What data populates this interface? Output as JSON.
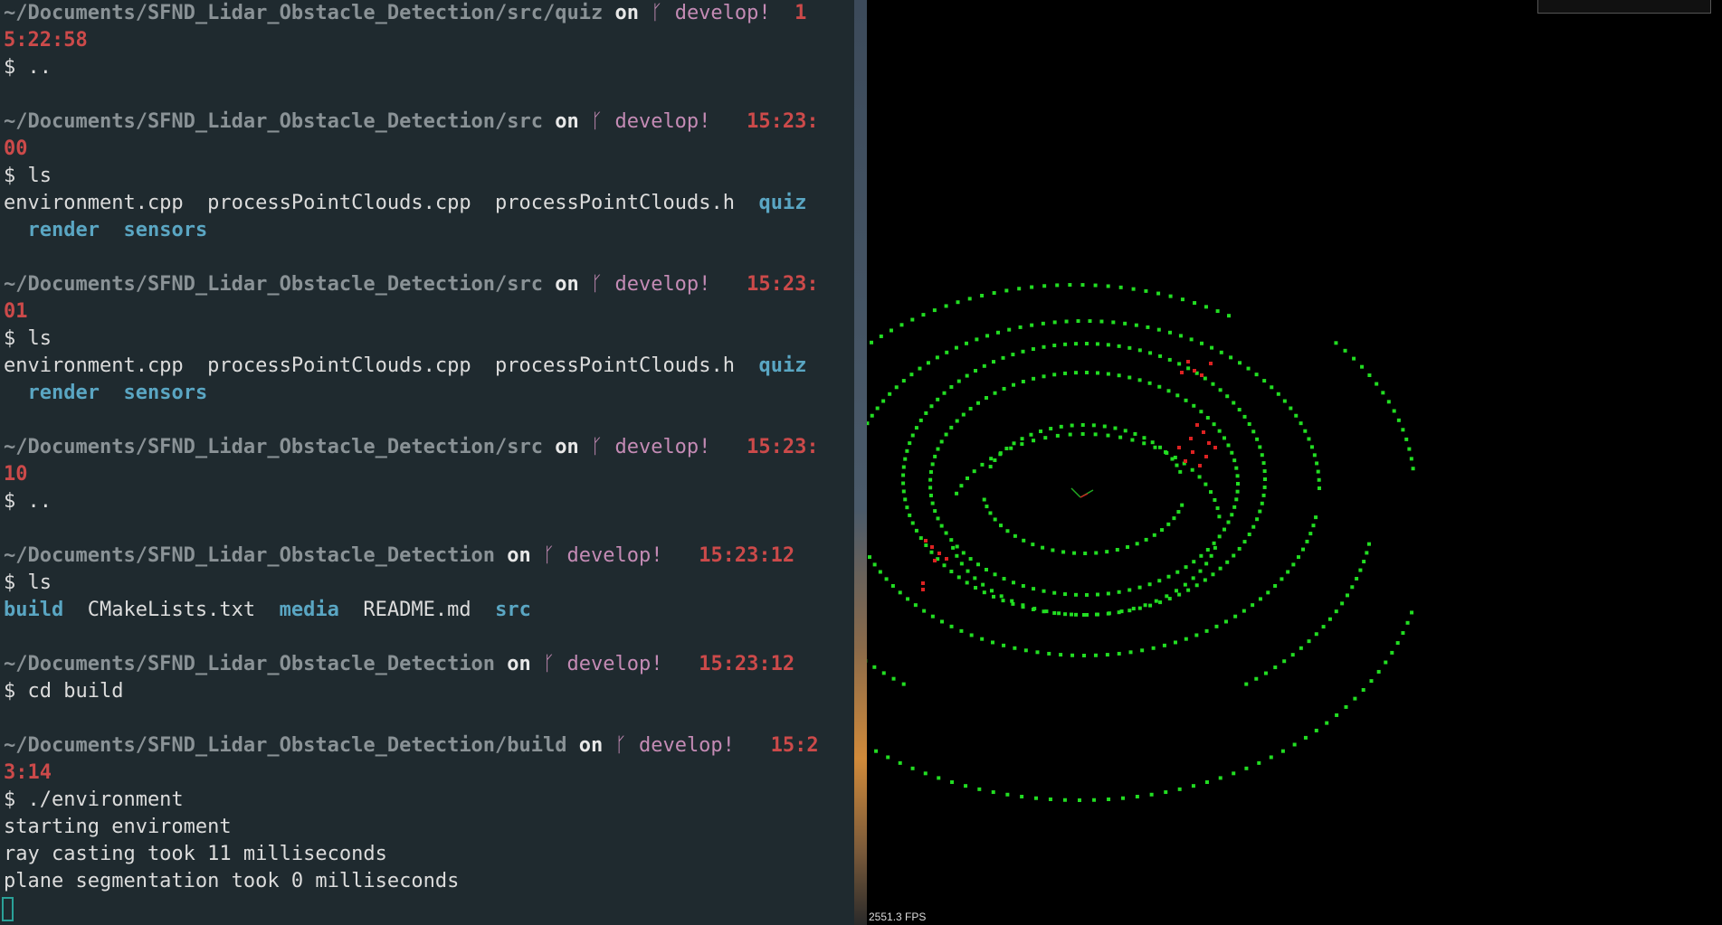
{
  "terminal": {
    "lines": [
      {
        "segs": [
          {
            "c": "path",
            "t": "~/Documents/SFND_Lidar_Obstacle_Detection/src/quiz"
          },
          {
            "c": "on",
            "t": " on "
          },
          {
            "c": "branch",
            "t": "ᚴ develop! "
          },
          {
            "c": "time",
            "t": " 1"
          }
        ]
      },
      {
        "segs": [
          {
            "c": "time",
            "t": "5:22:58"
          }
        ]
      },
      {
        "segs": [
          {
            "c": "text",
            "t": "$ .."
          }
        ]
      },
      {
        "segs": []
      },
      {
        "segs": [
          {
            "c": "path",
            "t": "~/Documents/SFND_Lidar_Obstacle_Detection/src"
          },
          {
            "c": "on",
            "t": " on "
          },
          {
            "c": "branch",
            "t": "ᚴ develop! "
          },
          {
            "c": "time",
            "t": "  15:23:"
          }
        ]
      },
      {
        "segs": [
          {
            "c": "time",
            "t": "00"
          }
        ]
      },
      {
        "segs": [
          {
            "c": "text",
            "t": "$ ls"
          }
        ]
      },
      {
        "segs": [
          {
            "c": "text",
            "t": "environment.cpp  processPointClouds.cpp  processPointClouds.h  "
          },
          {
            "c": "dir",
            "t": "quiz"
          }
        ]
      },
      {
        "segs": [
          {
            "c": "text",
            "t": "  "
          },
          {
            "c": "dir",
            "t": "render"
          },
          {
            "c": "text",
            "t": "  "
          },
          {
            "c": "dir",
            "t": "sensors"
          }
        ]
      },
      {
        "segs": []
      },
      {
        "segs": [
          {
            "c": "path",
            "t": "~/Documents/SFND_Lidar_Obstacle_Detection/src"
          },
          {
            "c": "on",
            "t": " on "
          },
          {
            "c": "branch",
            "t": "ᚴ develop! "
          },
          {
            "c": "time",
            "t": "  15:23:"
          }
        ]
      },
      {
        "segs": [
          {
            "c": "time",
            "t": "01"
          }
        ]
      },
      {
        "segs": [
          {
            "c": "text",
            "t": "$ ls"
          }
        ]
      },
      {
        "segs": [
          {
            "c": "text",
            "t": "environment.cpp  processPointClouds.cpp  processPointClouds.h  "
          },
          {
            "c": "dir",
            "t": "quiz"
          }
        ]
      },
      {
        "segs": [
          {
            "c": "text",
            "t": "  "
          },
          {
            "c": "dir",
            "t": "render"
          },
          {
            "c": "text",
            "t": "  "
          },
          {
            "c": "dir",
            "t": "sensors"
          }
        ]
      },
      {
        "segs": []
      },
      {
        "segs": [
          {
            "c": "path",
            "t": "~/Documents/SFND_Lidar_Obstacle_Detection/src"
          },
          {
            "c": "on",
            "t": " on "
          },
          {
            "c": "branch",
            "t": "ᚴ develop! "
          },
          {
            "c": "time",
            "t": "  15:23:"
          }
        ]
      },
      {
        "segs": [
          {
            "c": "time",
            "t": "10"
          }
        ]
      },
      {
        "segs": [
          {
            "c": "text",
            "t": "$ .."
          }
        ]
      },
      {
        "segs": []
      },
      {
        "segs": [
          {
            "c": "path",
            "t": "~/Documents/SFND_Lidar_Obstacle_Detection"
          },
          {
            "c": "on",
            "t": " on "
          },
          {
            "c": "branch",
            "t": "ᚴ develop! "
          },
          {
            "c": "time",
            "t": "  15:23:12"
          }
        ]
      },
      {
        "segs": [
          {
            "c": "text",
            "t": "$ ls"
          }
        ]
      },
      {
        "segs": [
          {
            "c": "dir",
            "t": "build"
          },
          {
            "c": "text",
            "t": "  CMakeLists.txt  "
          },
          {
            "c": "dir",
            "t": "media"
          },
          {
            "c": "text",
            "t": "  README.md  "
          },
          {
            "c": "dir",
            "t": "src"
          }
        ]
      },
      {
        "segs": []
      },
      {
        "segs": [
          {
            "c": "path",
            "t": "~/Documents/SFND_Lidar_Obstacle_Detection"
          },
          {
            "c": "on",
            "t": " on "
          },
          {
            "c": "branch",
            "t": "ᚴ develop! "
          },
          {
            "c": "time",
            "t": "  15:23:12"
          }
        ]
      },
      {
        "segs": [
          {
            "c": "text",
            "t": "$ cd build"
          }
        ]
      },
      {
        "segs": []
      },
      {
        "segs": [
          {
            "c": "path",
            "t": "~/Documents/SFND_Lidar_Obstacle_Detection/build"
          },
          {
            "c": "on",
            "t": " on "
          },
          {
            "c": "branch",
            "t": "ᚴ develop! "
          },
          {
            "c": "time",
            "t": "  15:2"
          }
        ]
      },
      {
        "segs": [
          {
            "c": "time",
            "t": "3:14"
          }
        ]
      },
      {
        "segs": [
          {
            "c": "text",
            "t": "$ ./environment"
          }
        ]
      },
      {
        "segs": [
          {
            "c": "text",
            "t": "starting enviroment"
          }
        ]
      },
      {
        "segs": [
          {
            "c": "text",
            "t": "ray casting took 11 milliseconds"
          }
        ]
      },
      {
        "segs": [
          {
            "c": "text",
            "t": "plane segmentation took 0 milliseconds"
          }
        ]
      }
    ]
  },
  "viewer": {
    "fps": "2551.3 FPS",
    "colors": {
      "ground": "#22dd22",
      "obstacle": "#dd2222",
      "background": "#000000"
    }
  }
}
